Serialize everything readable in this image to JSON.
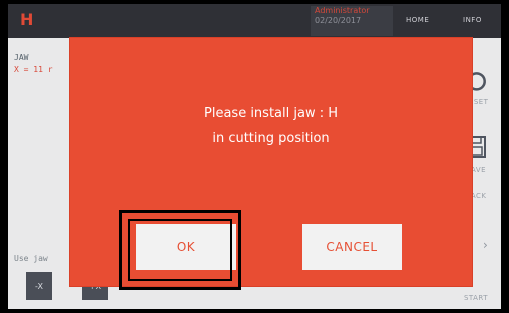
{
  "header": {
    "logo": "H",
    "user_name": "Administrator",
    "date": "02/20/2017",
    "tab_home": "HOME",
    "tab_info": "INFO"
  },
  "left_panel": {
    "label": "JAW",
    "value": "X = 11 r",
    "hint": "Use jaw",
    "minus_x": "-X",
    "plus_x": "+X"
  },
  "side_menu": {
    "reset": "RESET",
    "save": "SAVE",
    "back": "BACK",
    "start": "START"
  },
  "dialog": {
    "line1": "Please install jaw : H",
    "line2": "in cutting position",
    "ok_label": "OK",
    "cancel_label": "CANCEL"
  },
  "colors": {
    "dialog_bg": "#e84d33",
    "button_text": "#e65035",
    "topbar": "#2f3036"
  },
  "icons": [
    "reset-icon",
    "save-icon",
    "chevron-right-icon"
  ]
}
